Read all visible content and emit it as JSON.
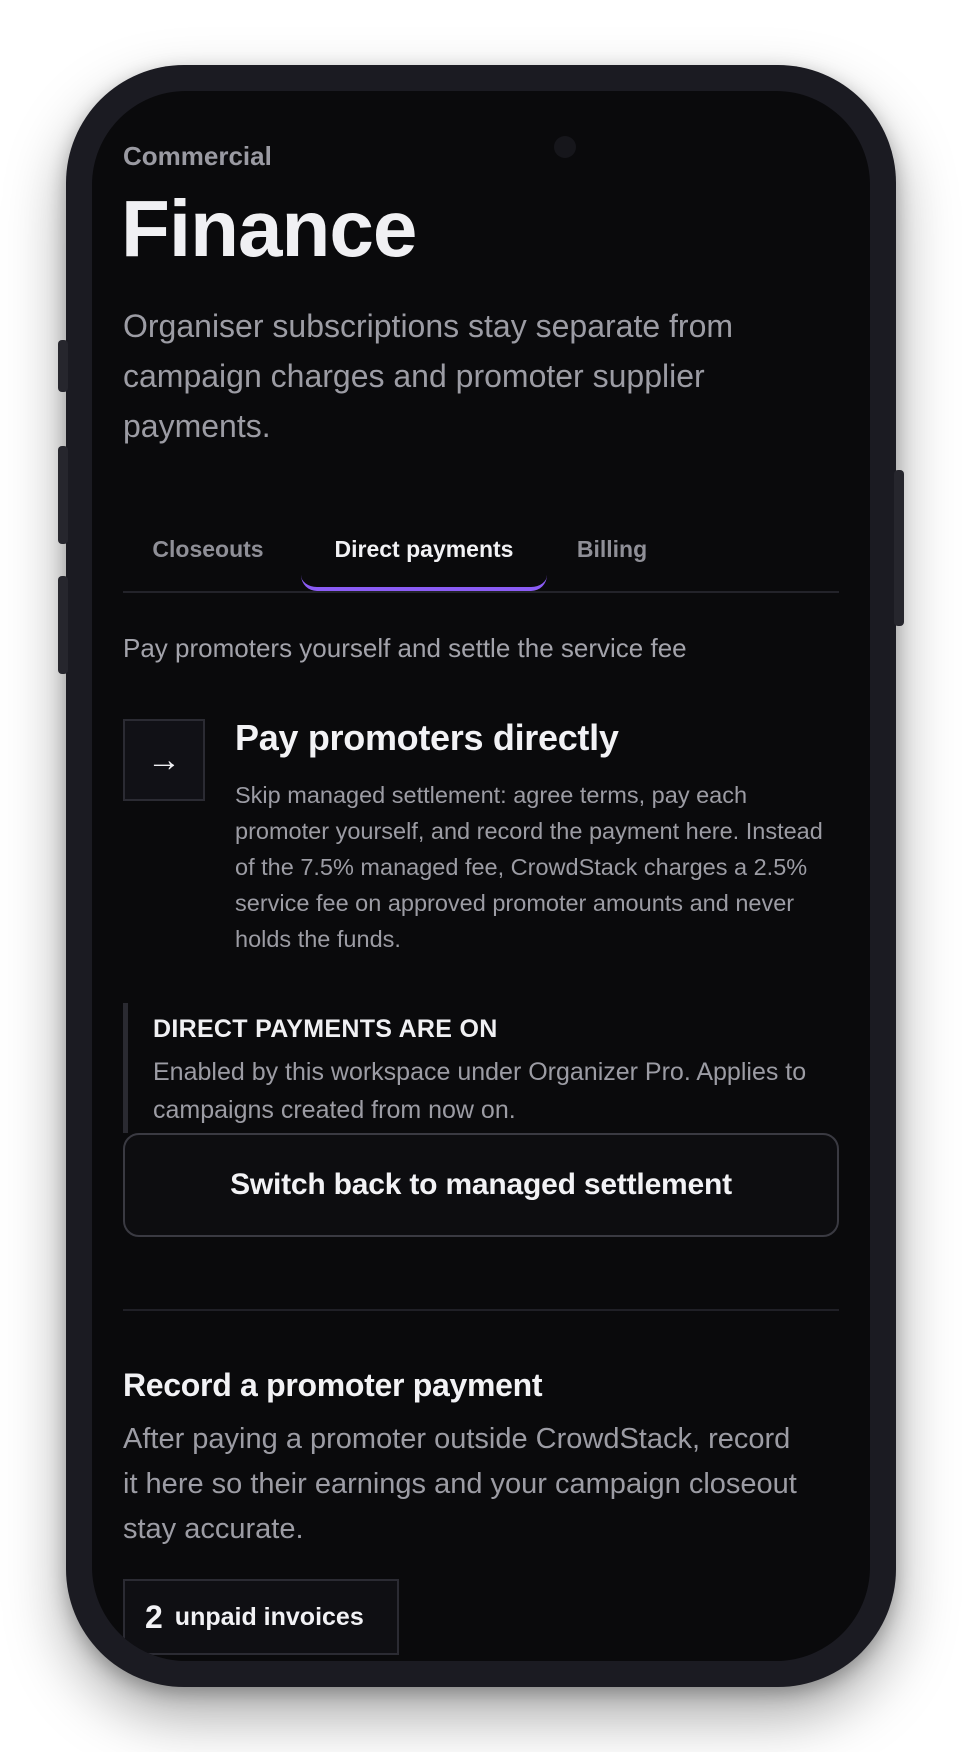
{
  "header": {
    "eyebrow": "Commercial",
    "title": "Finance",
    "subtitle": "Organiser subscriptions stay separate from campaign charges and promoter supplier payments."
  },
  "tabs": [
    {
      "label": "Closeouts",
      "active": false
    },
    {
      "label": "Direct payments",
      "active": true
    },
    {
      "label": "Billing",
      "active": false
    }
  ],
  "direct_payments": {
    "section_subtitle": "Pay promoters yourself and settle the service fee",
    "feature": {
      "icon": "arrow-right-icon",
      "icon_glyph": "→",
      "title": "Pay promoters directly",
      "description": "Skip managed settlement: agree terms, pay each promoter yourself, and record the payment here. Instead of the 7.5% managed fee, CrowdStack charges a 2.5% service fee on approved promoter amounts and never holds the funds."
    },
    "notice": {
      "title": "DIRECT PAYMENTS ARE ON",
      "body": "Enabled by this workspace under Organizer Pro. Applies to campaigns created from now on."
    },
    "switch_button_label": "Switch back to managed settlement"
  },
  "record_payment": {
    "title": "Record a promoter payment",
    "description": "After paying a promoter outside CrowdStack, record it here so their earnings and your campaign closeout stay accurate.",
    "unpaid_count": "2",
    "unpaid_label": "unpaid invoices"
  },
  "colors": {
    "background": "#0a0a0c",
    "accent": "#8b5cf6",
    "text_primary": "#f2f2f5",
    "text_muted": "#9c9ca4"
  }
}
